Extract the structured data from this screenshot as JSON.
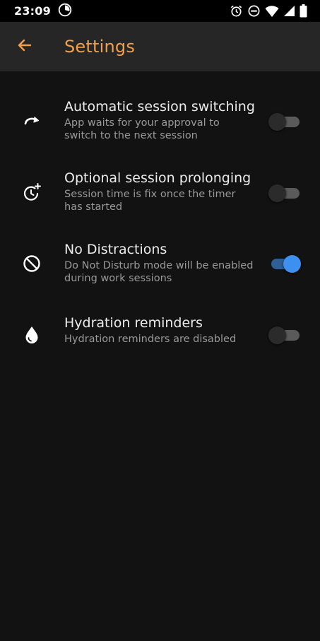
{
  "status_bar": {
    "time": "23:09",
    "icons": [
      "timer-app-icon",
      "alarm-icon",
      "do-not-disturb-icon",
      "wifi-icon",
      "cell-signal-icon",
      "battery-icon"
    ]
  },
  "app_bar": {
    "title": "Settings",
    "accent_color": "#f0a04b",
    "back_icon": "arrow-left-icon"
  },
  "settings": [
    {
      "icon": "redo-arrow-icon",
      "title": "Automatic session switching",
      "summary": "App waits for your approval to switch to the next session",
      "enabled": false
    },
    {
      "icon": "timer-plus-icon",
      "title": "Optional session prolonging",
      "summary": "Session time is fix once the timer has started",
      "enabled": false
    },
    {
      "icon": "block-icon",
      "title": "No Distractions",
      "summary": "Do Not Disturb mode will be enabled during work sessions",
      "enabled": true
    },
    {
      "icon": "water-drop-icon",
      "title": "Hydration reminders",
      "summary": "Hydration reminders are disabled",
      "enabled": false
    }
  ],
  "colors": {
    "background": "#121212",
    "app_bar": "#262626",
    "switch_on": "#3d8ff0"
  }
}
